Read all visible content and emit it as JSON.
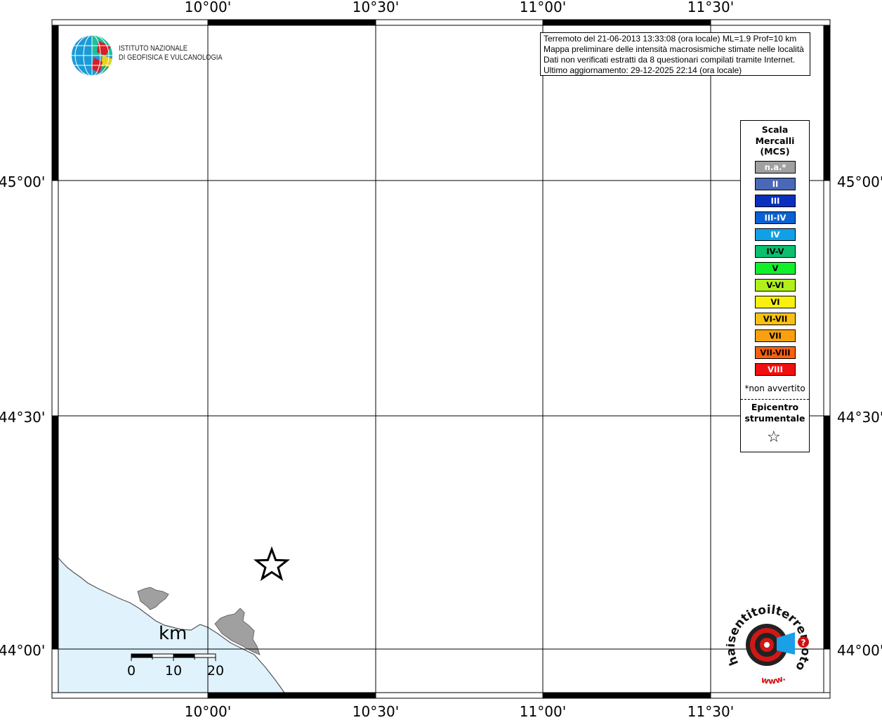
{
  "axes": {
    "lon_labels": [
      "10°00'",
      "10°30'",
      "11°00'",
      "11°30'"
    ],
    "lat_labels": [
      "45°00'",
      "44°30'",
      "44°00'"
    ]
  },
  "info_box": {
    "lines": [
      "Terremoto del 21-06-2013 13:33:08 (ora locale) ML=1.9 Prof=10 km",
      "Mappa preliminare delle intensità macrosismiche stimate nelle località",
      "Dati non verificati estratti da 8 questionari compilati tramite Internet.",
      "Ultimo aggiornamento: 29-12-2025 22:14 (ora locale)"
    ]
  },
  "logo_ingv": {
    "line1": "ISTITUTO NAZIONALE",
    "line2": "DI GEOFISICA E VULCANOLOGIA"
  },
  "legend": {
    "title_lines": [
      "Scala",
      "Mercalli",
      "(MCS)"
    ],
    "items": [
      {
        "label": "n.a.*",
        "color": "#a0a0a0"
      },
      {
        "label": "II",
        "color": "#4a68b8"
      },
      {
        "label": "III",
        "color": "#0a2fbf"
      },
      {
        "label": "III-IV",
        "color": "#0a62d2"
      },
      {
        "label": "IV",
        "color": "#10a0e8"
      },
      {
        "label": "IV-V",
        "color": "#0bbf6e"
      },
      {
        "label": "V",
        "color": "#10f02a"
      },
      {
        "label": "V-VI",
        "color": "#b0f01a"
      },
      {
        "label": "VI",
        "color": "#f8f010"
      },
      {
        "label": "VI-VII",
        "color": "#f8c010"
      },
      {
        "label": "VII",
        "color": "#f8a010"
      },
      {
        "label": "VII-VIII",
        "color": "#f86010"
      },
      {
        "label": "VIII",
        "color": "#f01010"
      }
    ],
    "dark_text_labels": [
      "IV-V",
      "V",
      "V-VI",
      "VI",
      "VI-VII",
      "VII",
      "VII-VIII"
    ],
    "note": "*non avvertito",
    "epicenter_lines": [
      "Epicentro",
      "strumentale"
    ]
  },
  "scale_bar": {
    "unit": "km",
    "ticks": [
      "0",
      "10",
      "20"
    ]
  },
  "epicenter": {
    "lon": 10.19,
    "lat": 44.18
  },
  "colors": {
    "sea": "#e0f2fc",
    "land_gray": "#a0a0a0",
    "frame": "#000000"
  },
  "hs_logo": {
    "text": "haisentitoilterremoto.it",
    "url_text": "www."
  }
}
